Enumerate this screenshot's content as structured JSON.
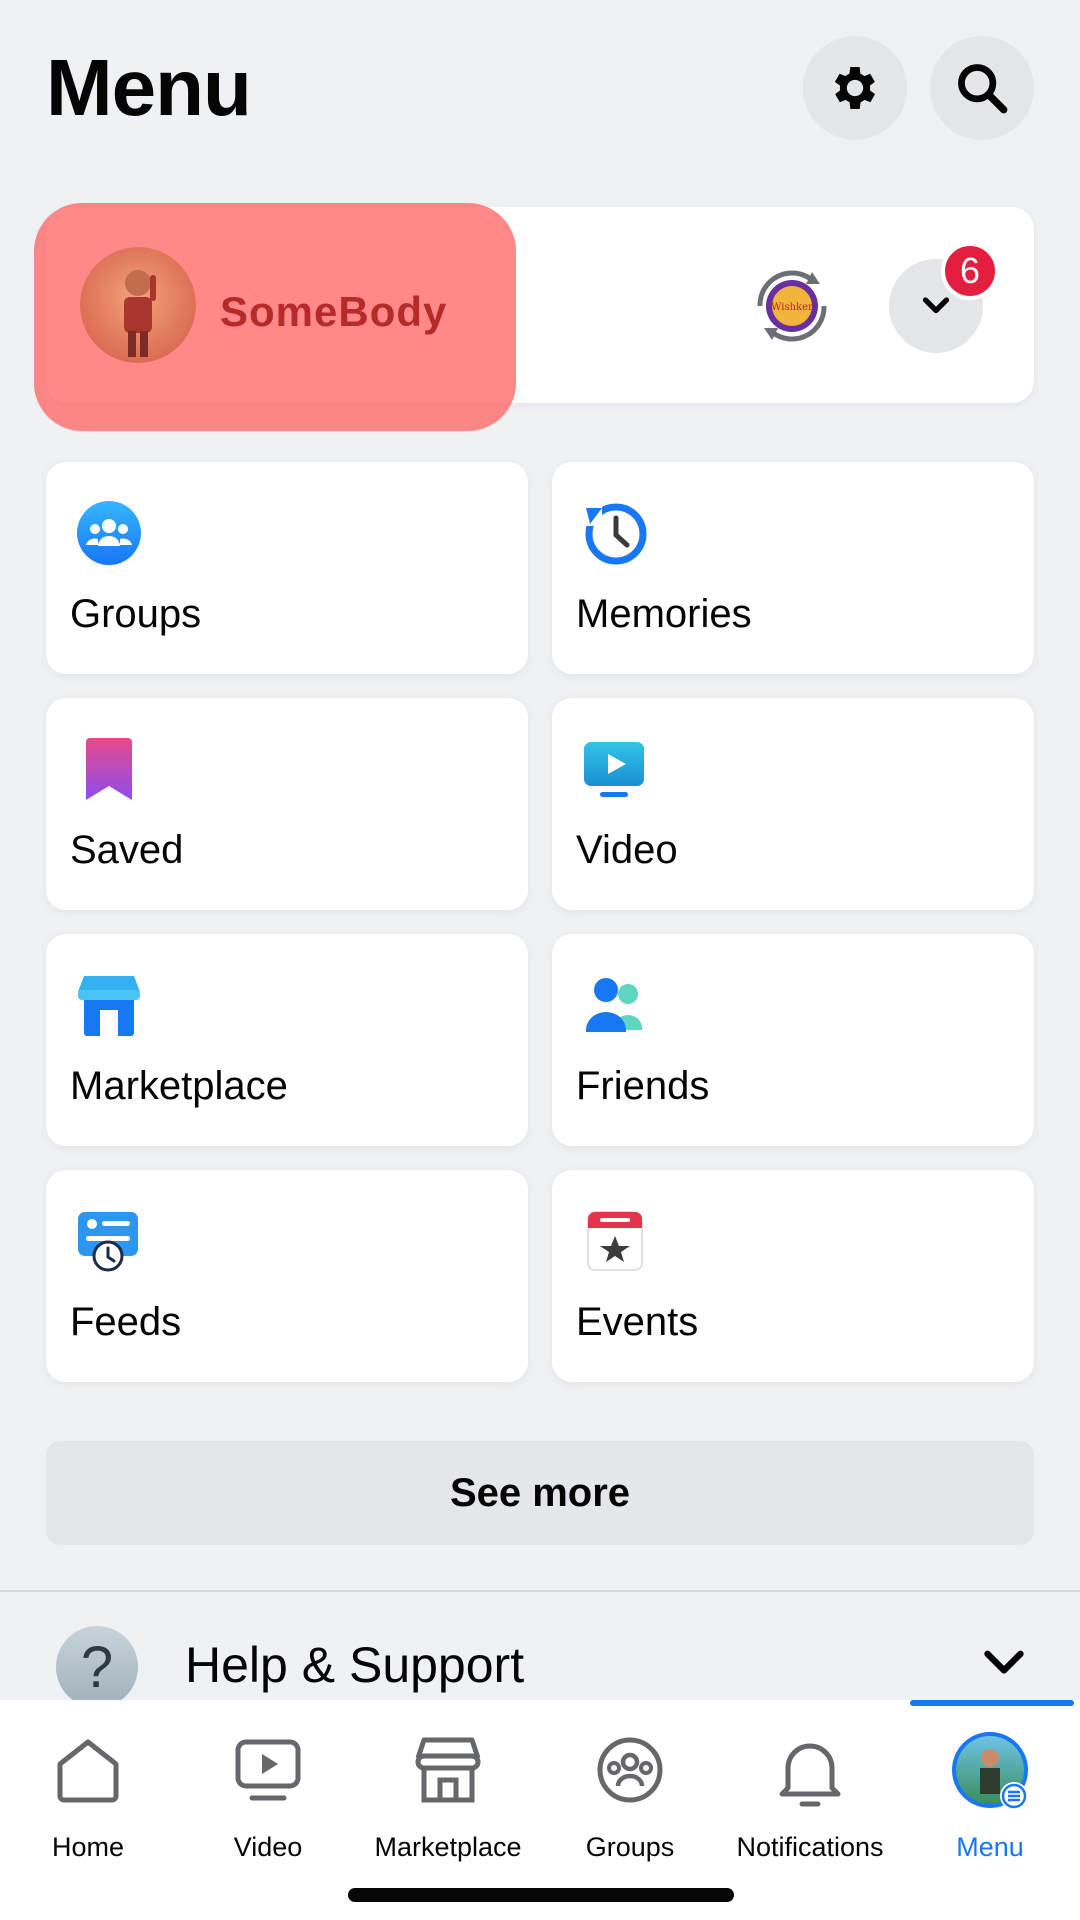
{
  "header": {
    "title": "Menu"
  },
  "profile": {
    "name": "SomeBody",
    "notification_count": "6"
  },
  "shortcuts": [
    {
      "label": "Groups",
      "icon": "groups-icon"
    },
    {
      "label": "Memories",
      "icon": "memories-icon"
    },
    {
      "label": "Saved",
      "icon": "saved-icon"
    },
    {
      "label": "Video",
      "icon": "video-icon"
    },
    {
      "label": "Marketplace",
      "icon": "marketplace-icon"
    },
    {
      "label": "Friends",
      "icon": "friends-icon"
    },
    {
      "label": "Feeds",
      "icon": "feeds-icon"
    },
    {
      "label": "Events",
      "icon": "events-icon"
    }
  ],
  "see_more": "See more",
  "help": {
    "label": "Help & Support"
  },
  "nav": [
    {
      "label": "Home",
      "icon": "home-icon"
    },
    {
      "label": "Video",
      "icon": "video-icon"
    },
    {
      "label": "Marketplace",
      "icon": "marketplace-icon"
    },
    {
      "label": "Groups",
      "icon": "groups-icon"
    },
    {
      "label": "Notifications",
      "icon": "bell-icon"
    },
    {
      "label": "Menu",
      "icon": "avatar",
      "active": true
    }
  ],
  "colors": {
    "accent": "#1877f2",
    "badge": "#e41e3f",
    "background": "#eff1f5"
  }
}
